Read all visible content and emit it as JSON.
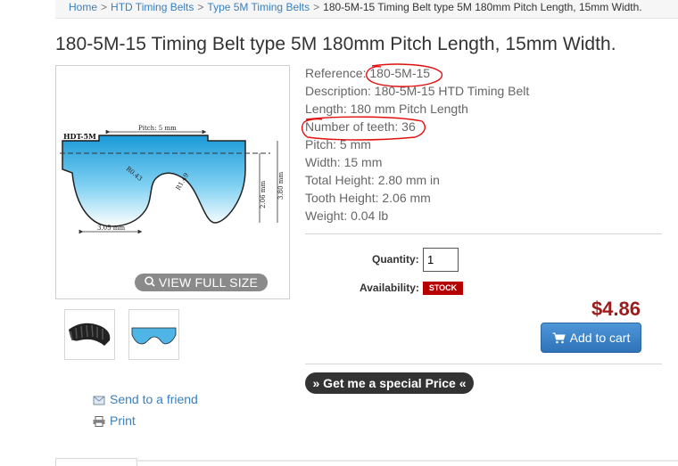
{
  "breadcrumb": {
    "home": "Home",
    "sep": ">",
    "level1": "HTD Timing Belts",
    "level2": "Type 5M Timing Belts",
    "current": "180-5M-15 Timing Belt type 5M 180mm Pitch Length, 15mm Width."
  },
  "product": {
    "title": "180-5M-15 Timing Belt type 5M 180mm Pitch Length, 15mm Width.",
    "specs": [
      "Reference: 180-5M-15",
      "Description: 180-5M-15 HTD Timing Belt",
      "Length: 180 mm Pitch Length",
      "Number of teeth: 36",
      "Pitch: 5 mm",
      "Width: 15 mm",
      "Total Height: 2.80 mm in",
      "Tooth Height: 2.06 mm",
      "Weight: 0.04 lb"
    ]
  },
  "diagram": {
    "label": "HDT-5M",
    "pitch": "Pitch: 5 mm",
    "radius1": "R0.43",
    "radius2": "R1.49",
    "height1": "2.06 mm",
    "height2": "3.80 mm",
    "width": "3.05 mm"
  },
  "image": {
    "view_full": "VIEW FULL SIZE"
  },
  "purchase": {
    "quantity_label": "Quantity:",
    "quantity_value": "1",
    "availability_label": "Availability:",
    "stock_badge": "STOCK",
    "price": "$4.86",
    "add_to_cart": "Add to cart",
    "special_price": "» Get me a special Price «"
  },
  "links": {
    "send_friend": "Send to a friend",
    "print": "Print"
  },
  "colors": {
    "link": "#3a80c0",
    "price": "#9b1c1c",
    "stock_badge": "#b40000",
    "add_to_cart": "#3a80c0",
    "annotation": "#e01010"
  }
}
